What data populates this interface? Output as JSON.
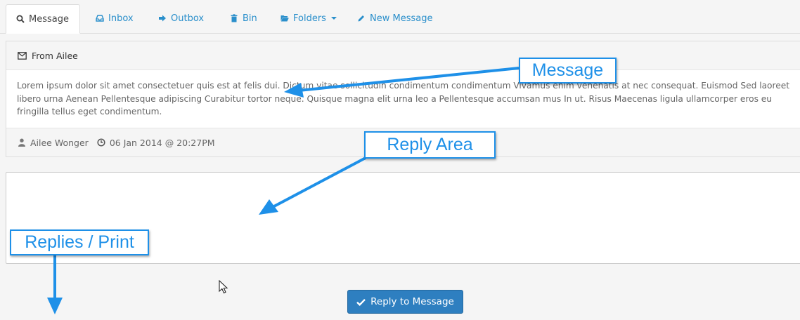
{
  "tabs": [
    {
      "label": "Message",
      "icon": "search-icon",
      "active": true
    },
    {
      "label": "Inbox",
      "icon": "inbox-icon",
      "active": false
    },
    {
      "label": "Outbox",
      "icon": "sign-out-icon",
      "active": false
    },
    {
      "label": "Bin",
      "icon": "trash-icon",
      "active": false
    },
    {
      "label": "Folders",
      "icon": "folder-open-icon",
      "active": false
    },
    {
      "label": "New Message",
      "icon": "pencil-icon",
      "active": false
    }
  ],
  "message": {
    "header": "From Ailee",
    "body": "Lorem ipsum dolor sit amet consectetuer quis est at felis dui. Dictum vitae sollicitudin condimentum condimentum Vivamus enim venenatis at nec consequat. Euismod Sed laoreet libero urna Aenean Pellentesque adipiscing Curabitur tortor neque. Quisque magna elit urna leo a Pellentesque accumsan mus In ut. Risus Maecenas ligula ullamcorper eros eu fringilla tellus eget condimentum.",
    "author": "Ailee Wonger",
    "date": "06 Jan 2014 @ 20:27PM"
  },
  "reply": {
    "value": "",
    "button_label": "Reply to Message"
  },
  "callouts": {
    "message": "Message",
    "reply_area": "Reply Area",
    "replies_print": "Replies / Print"
  },
  "colors": {
    "link": "#2a8fcb",
    "button": "#2e7fc0",
    "callout": "#1e90e8"
  }
}
